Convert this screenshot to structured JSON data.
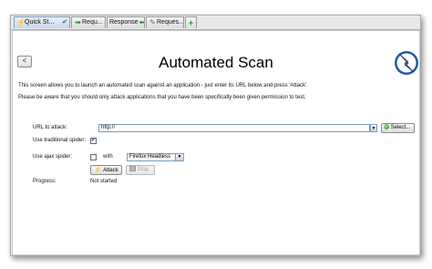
{
  "tabs": [
    {
      "label": "Quick St...",
      "icon": "lightning-icon",
      "active": true
    },
    {
      "label": "Requ...",
      "icon": "arrow-right-icon",
      "active": false
    },
    {
      "label": "Response",
      "icon": "arrow-left-icon",
      "active": false
    },
    {
      "label": "Reques...",
      "icon": "pencil-icon",
      "active": false
    },
    {
      "label": "+",
      "icon": "plus-icon",
      "active": false
    }
  ],
  "main": {
    "back_label": "<",
    "title": "Automated Scan",
    "description": "This screen allows you to launch an automated scan against  an application - just enter its URL below and press 'Attack'.",
    "warning": "Please be aware that you should only attack applications that you have been specifically been given permission to test."
  },
  "form": {
    "url_label": "URL to attack:",
    "url_value": "http://",
    "select_label": "Select...",
    "traditional_label": "Use traditional spider:",
    "traditional_checked": true,
    "ajax_label": "Use ajax spider:",
    "ajax_checked": false,
    "with_label": "with",
    "browser_value": "Firefox Headless",
    "attack_label": "Attack",
    "stop_label": "Stop",
    "progress_label": "Progress:",
    "progress_value": "Not started"
  },
  "colors": {
    "accent": "#2e8b2e",
    "logo_blue": "#1d5aa8"
  }
}
